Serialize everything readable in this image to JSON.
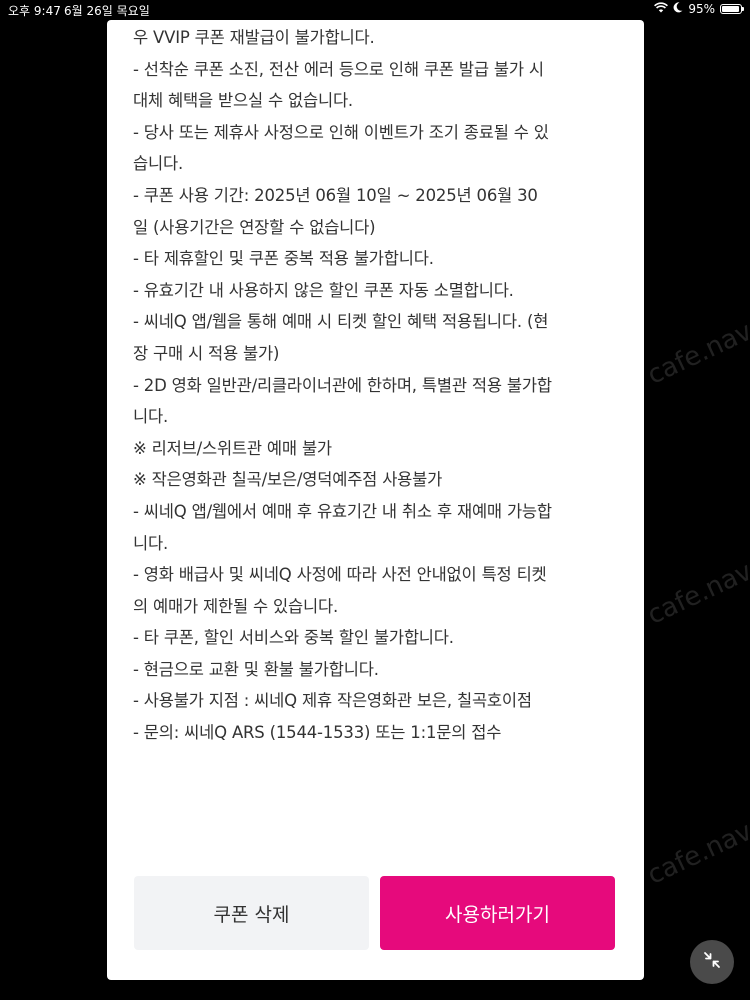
{
  "status_bar": {
    "time": "오후 9:47",
    "date": "6월 26일 목요일",
    "battery": "95%",
    "icons": [
      "wifi-icon",
      "moon-icon",
      "battery-icon"
    ]
  },
  "watermark": "cafe.naver.com",
  "notice_lines": [
    "우 VVIP 쿠폰 재발급이 불가합니다.",
    "- 선착순 쿠폰 소진, 전산 에러 등으로 인해 쿠폰 발급 불가 시",
    "대체 혜택을 받으실 수 없습니다.",
    "- 당사 또는 제휴사 사정으로 인해 이벤트가 조기 종료될 수 있",
    "습니다.",
    "- 쿠폰 사용 기간: 2025년 06월 10일 ~ 2025년 06월 30",
    "일 (사용기간은 연장할 수 없습니다)",
    "- 타 제휴할인 및 쿠폰 중복 적용 불가합니다.",
    "- 유효기간 내 사용하지 않은 할인 쿠폰 자동 소멸합니다.",
    "- 씨네Q 앱/웹을 통해 예매 시 티켓 할인 혜택 적용됩니다. (현",
    "장 구매 시 적용 불가)",
    "- 2D 영화 일반관/리클라이너관에 한하며, 특별관 적용 불가합",
    "니다.",
    "※ 리저브/스위트관 예매 불가",
    "※ 작은영화관 칠곡/보은/영덕예주점 사용불가",
    "- 씨네Q 앱/웹에서 예매 후 유효기간 내 취소 후 재예매 가능합",
    "니다.",
    "- 영화 배급사 및 씨네Q 사정에 따라 사전 안내없이 특정 티켓",
    "의 예매가 제한될 수 있습니다.",
    "- 타 쿠폰, 할인 서비스와 중복 할인 불가합니다.",
    "- 현금으로 교환 및 환불 불가합니다.",
    "- 사용불가 지점 : 씨네Q 제휴 작은영화관 보은, 칠곡호이점",
    "- 문의: 씨네Q ARS (1544-1533) 또는 1:1문의 접수"
  ],
  "buttons": {
    "delete_label": "쿠폰 삭제",
    "use_label": "사용하러가기"
  },
  "colors": {
    "accent": "#e60a7c",
    "secondary_button": "#f2f3f5",
    "text": "#333333",
    "background": "#000000"
  }
}
